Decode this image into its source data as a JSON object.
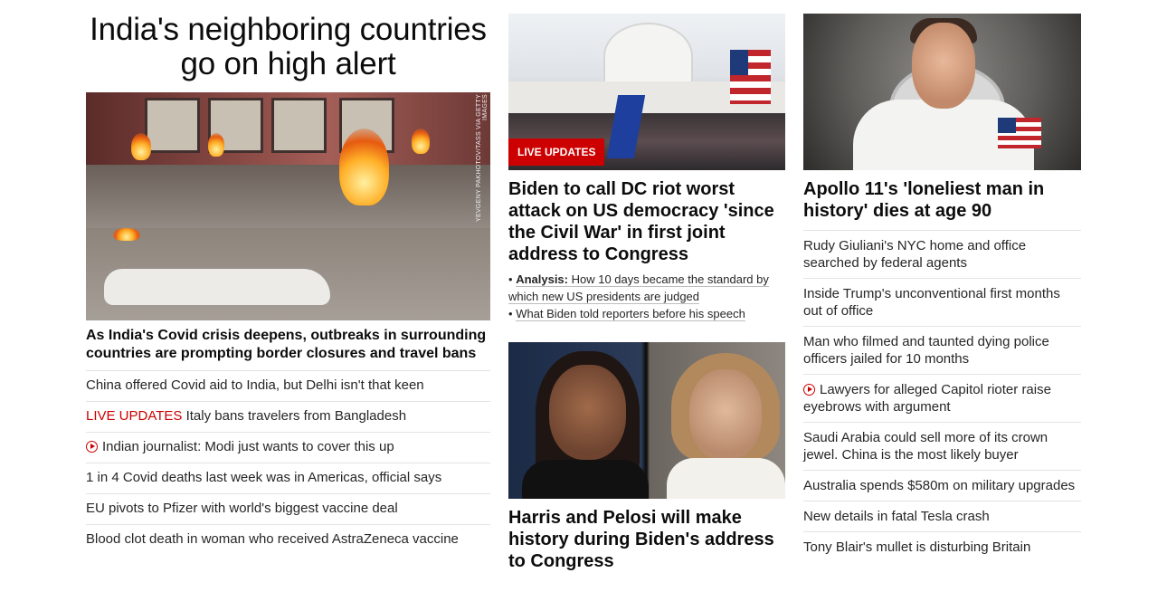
{
  "col1": {
    "headline": "India's neighboring countries go on high alert",
    "photo_credit": "YEVGENY PAKHOTOV/TASS VIA GETTY IMAGES",
    "lead": "As India's Covid crisis deepens, outbreaks in surrounding countries are prompting border closures and travel bans",
    "links": [
      {
        "text": "China offered Covid aid to India, but Delhi isn't that keen"
      },
      {
        "prefix": "LIVE UPDATES",
        "text": " Italy bans travelers from Bangladesh"
      },
      {
        "text": "Indian journalist: Modi just wants to cover this up",
        "icon": "play-icon"
      },
      {
        "text": "1 in 4 Covid deaths last week was in Americas, official says"
      },
      {
        "text": "EU pivots to Pfizer with world's biggest vaccine deal"
      },
      {
        "text": "Blood clot death in woman who received AstraZeneca vaccine"
      }
    ]
  },
  "col2": {
    "badge": "LIVE UPDATES",
    "headline1": "Biden to call DC riot worst attack on US democracy 'since the Civil War' in first joint address to Congress",
    "sub1_label": "Analysis:",
    "sub1_text": " How 10 days became the standard by which new US presidents are judged",
    "sub2_text": "What Biden told reporters before his speech",
    "bullet": "•",
    "headline2": "Harris and Pelosi will make history during Biden's address to Congress"
  },
  "col3": {
    "headline": "Apollo 11's 'loneliest man in history' dies at age 90",
    "links": [
      {
        "text": "Rudy Giuliani's NYC home and office searched by federal agents"
      },
      {
        "text": "Inside Trump's unconventional first months out of office"
      },
      {
        "text": "Man who filmed and taunted dying police officers jailed for 10 months"
      },
      {
        "text": "Lawyers for alleged Capitol rioter raise eyebrows with argument",
        "icon": "play-icon"
      },
      {
        "text": "Saudi Arabia could sell more of its crown jewel. China is the most likely buyer"
      },
      {
        "text": "Australia spends $580m on military upgrades"
      },
      {
        "text": "New details in fatal Tesla crash"
      },
      {
        "text": "Tony Blair's mullet is disturbing Britain"
      }
    ]
  },
  "colors": {
    "accent_red": "#cc0000",
    "text": "#262626",
    "divider": "#e3e3e3"
  }
}
